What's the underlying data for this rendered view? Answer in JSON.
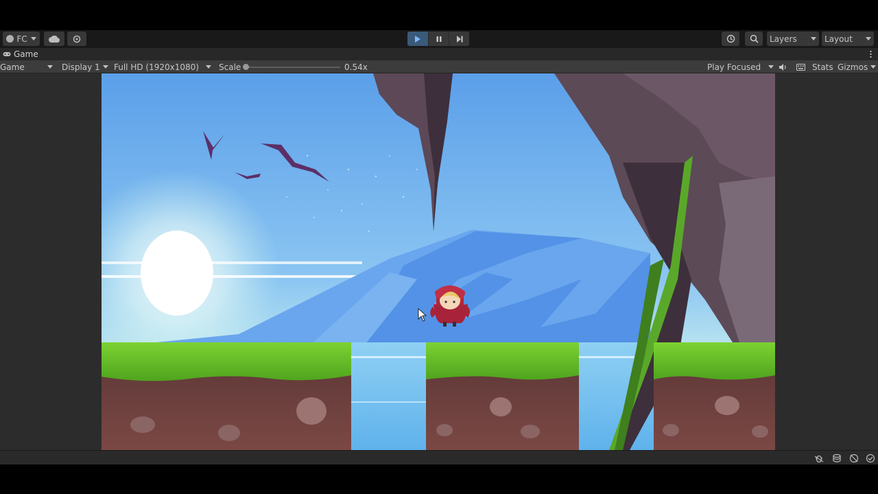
{
  "topbar": {
    "account_label": "FC",
    "layers_label": "Layers",
    "layout_label": "Layout"
  },
  "tab": {
    "title": "Game"
  },
  "toolbar": {
    "view_mode": "Game",
    "display": "Display 1",
    "resolution": "Full HD (1920x1080)",
    "scale_label": "Scale",
    "scale_value": "0.54x",
    "scale_level": 0.0,
    "play_mode": "Play Focused",
    "stats_label": "Stats",
    "gizmos_label": "Gizmos"
  },
  "colors": {
    "play_active": "#3a5a7a",
    "editor_bg": "#191919",
    "sky_top": "#5aa0ea",
    "grass": "#6cc42a",
    "dirt": "#6b3f3c",
    "rock": "#5d4a57"
  },
  "icons": [
    "account-icon",
    "cloud-icon",
    "collab-icon",
    "play-icon",
    "pause-icon",
    "step-icon",
    "history-icon",
    "search-icon",
    "audio-icon",
    "keyboard-icon",
    "bug-icon",
    "database-icon",
    "network-icon",
    "check-icon"
  ]
}
